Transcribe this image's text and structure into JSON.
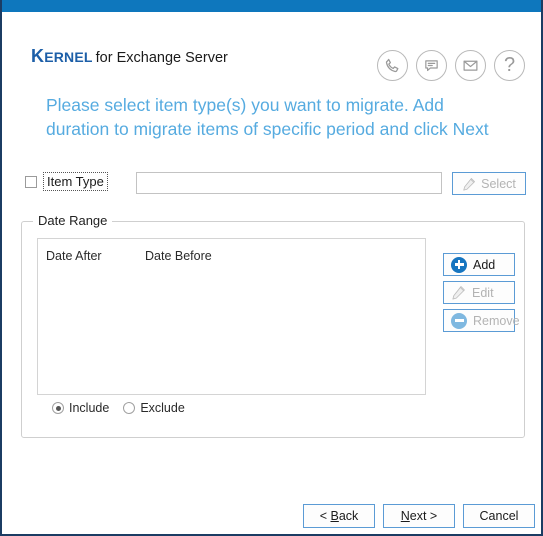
{
  "window": {
    "titlebar_color": "#0e77bd",
    "border_color": "#1b3c63"
  },
  "header": {
    "logo_primary": "KERNEL",
    "logo_secondary": "for Exchange Server",
    "logo_color": "#1d5fa8",
    "icons": [
      {
        "name": "phone-icon",
        "label": "Call support"
      },
      {
        "name": "chat-icon",
        "label": "Live chat"
      },
      {
        "name": "email-icon",
        "label": "Email support"
      },
      {
        "name": "help-icon",
        "label": "?"
      }
    ]
  },
  "instructions": {
    "text": "Please select item type(s) you want to migrate. Add duration to migrate items of specific period and click Next",
    "color": "#56abe0"
  },
  "item_type": {
    "checkbox_label": "Item Type",
    "checkbox_checked": false,
    "input_value": "",
    "input_placeholder": "",
    "select_button": {
      "label": "Select",
      "icon": "pencil-icon",
      "enabled": false
    }
  },
  "date_range": {
    "group_title": "Date Range",
    "columns": [
      "Date After",
      "Date Before"
    ],
    "rows": [],
    "buttons": [
      {
        "label": "Add",
        "icon": "plus-circle-icon",
        "enabled": true
      },
      {
        "label": "Edit",
        "icon": "pencil-icon",
        "enabled": false
      },
      {
        "label": "Remove",
        "icon": "minus-circle-icon",
        "enabled": false
      }
    ],
    "filter_mode": {
      "selected": "Include",
      "options": [
        "Include",
        "Exclude"
      ]
    }
  },
  "footer": {
    "back_button": "< Back",
    "next_button": "Next >",
    "cancel_button": "Cancel"
  }
}
